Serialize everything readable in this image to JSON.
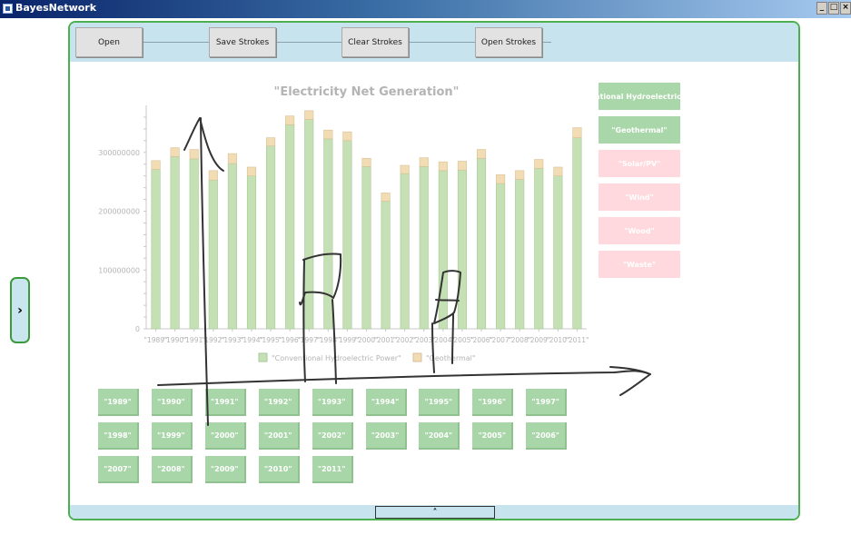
{
  "window": {
    "title": "BayesNetwork",
    "controls": [
      "_",
      "□",
      "×"
    ]
  },
  "side_toggle": {
    "icon": "chevron-right-icon",
    "glyph": "›"
  },
  "toolbar": {
    "buttons": [
      "Open",
      "Save Strokes",
      "Clear Strokes",
      "Open Strokes"
    ]
  },
  "series_toggles": [
    {
      "label": "\"Conventional Hydroelectric Power\"",
      "state": "on"
    },
    {
      "label": "\"Geothermal\"",
      "state": "on"
    },
    {
      "label": "\"Solar/PV\"",
      "state": "off"
    },
    {
      "label": "\"Wind\"",
      "state": "off"
    },
    {
      "label": "\"Wood\"",
      "state": "off"
    },
    {
      "label": "\"Waste\"",
      "state": "off"
    }
  ],
  "year_buttons": [
    "\"1989\"",
    "\"1990\"",
    "\"1991\"",
    "\"1992\"",
    "\"1993\"",
    "\"1994\"",
    "\"1995\"",
    "\"1996\"",
    "\"1997\"",
    "\"1998\"",
    "\"1999\"",
    "\"2000\"",
    "\"2001\"",
    "\"2002\"",
    "\"2003\"",
    "\"2004\"",
    "\"2005\"",
    "\"2006\"",
    "\"2007\"",
    "\"2008\"",
    "\"2009\"",
    "\"2010\"",
    "\"2011\""
  ],
  "bottom_bar": {
    "icon": "chevron-up-icon",
    "glyph": "˄"
  },
  "colors": {
    "hydro": "#c4e0b4",
    "geo": "#f2dcb4",
    "toggle_on": "#aad7aa",
    "toggle_off": "#ffd9dd",
    "panel_border": "#4caf50",
    "toolbar_bg": "#c7e4ee"
  },
  "chart_data": {
    "type": "bar",
    "stacked": true,
    "title": "\"Electricity Net Generation\"",
    "categories": [
      "\"1989\"",
      "\"1990\"",
      "\"1991\"",
      "\"1992\"",
      "\"1993\"",
      "\"1994\"",
      "\"1995\"",
      "\"1996\"",
      "\"1997\"",
      "\"1998\"",
      "\"1999\"",
      "\"2000\"",
      "\"2001\"",
      "\"2002\"",
      "\"2003\"",
      "\"2004\"",
      "\"2005\"",
      "\"2006\"",
      "\"2007\"",
      "\"2008\"",
      "\"2009\"",
      "\"2010\"",
      "\"2011\""
    ],
    "series": [
      {
        "name": "\"Conventional Hydroelectric Power\"",
        "values": [
          271000000,
          293000000,
          289000000,
          253000000,
          281000000,
          260000000,
          311000000,
          347000000,
          356000000,
          323000000,
          320000000,
          276000000,
          217000000,
          264000000,
          276000000,
          269000000,
          270000000,
          290000000,
          247000000,
          254000000,
          273000000,
          260000000,
          325000000
        ]
      },
      {
        "name": "\"Geothermal\"",
        "values": [
          15000000,
          15000000,
          16000000,
          16000000,
          17000000,
          15000000,
          14000000,
          15000000,
          15000000,
          15000000,
          15000000,
          14000000,
          14000000,
          14000000,
          15000000,
          15000000,
          15000000,
          15000000,
          15000000,
          15000000,
          15000000,
          15000000,
          17000000
        ]
      }
    ],
    "yticks": [
      "0",
      "100000000",
      "200000000",
      "300000000"
    ],
    "ylim": [
      0,
      380000000
    ],
    "legend": "bottom",
    "grid": false
  }
}
